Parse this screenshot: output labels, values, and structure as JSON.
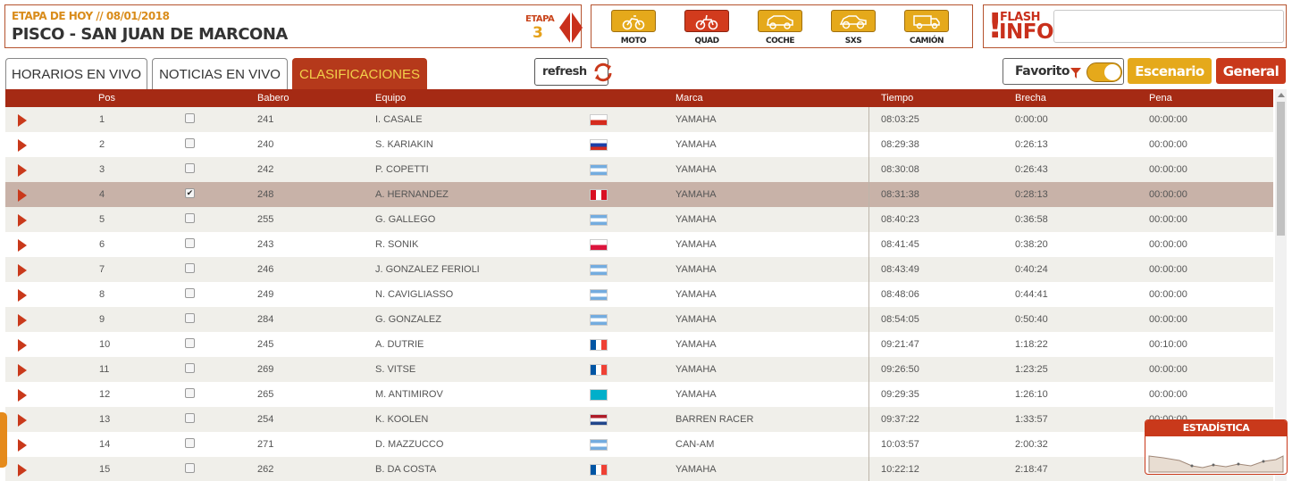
{
  "header": {
    "stage_label": "ETAPA DE HOY // 08/01/2018",
    "stage_name": "PISCO - SAN JUAN DE MARCONA",
    "etapa_label": "ETAPA",
    "etapa_number": "3"
  },
  "categories": [
    {
      "label": "MOTO",
      "icon": "motorbike-icon",
      "active": false
    },
    {
      "label": "QUAD",
      "icon": "quad-icon",
      "active": true
    },
    {
      "label": "COCHE",
      "icon": "car-icon",
      "active": false
    },
    {
      "label": "SXS",
      "icon": "sxs-icon",
      "active": false
    },
    {
      "label": "CAMIÓN",
      "icon": "truck-icon",
      "active": false
    }
  ],
  "flash": {
    "line1": "FLASH",
    "line2": "INFO"
  },
  "tabs": [
    {
      "label": "HORARIOS EN VIVO",
      "active": false
    },
    {
      "label": "NOTICIAS EN VIVO",
      "active": false
    },
    {
      "label": "CLASIFICACIONES",
      "active": true
    }
  ],
  "toolbar": {
    "refresh_label": "refresh",
    "favorito_label": "Favorito",
    "escenario_label": "Escenario",
    "general_label": "General"
  },
  "table": {
    "columns": {
      "pos": "Pos",
      "babero": "Babero",
      "equipo": "Equipo",
      "marca": "Marca",
      "tiempo": "Tiempo",
      "brecha": "Brecha",
      "pena": "Pena"
    },
    "rows": [
      {
        "pos": "1",
        "babero": "241",
        "equipo": "I. CASALE",
        "flag": "chile",
        "marca": "YAMAHA",
        "tiempo": "08:03:25",
        "brecha": "0:00:00",
        "pena": "00:00:00",
        "checked": false
      },
      {
        "pos": "2",
        "babero": "240",
        "equipo": "S. KARIAKIN",
        "flag": "russia",
        "marca": "YAMAHA",
        "tiempo": "08:29:38",
        "brecha": "0:26:13",
        "pena": "00:00:00",
        "checked": false
      },
      {
        "pos": "3",
        "babero": "242",
        "equipo": "P. COPETTI",
        "flag": "argentina",
        "marca": "YAMAHA",
        "tiempo": "08:30:08",
        "brecha": "0:26:43",
        "pena": "00:00:00",
        "checked": false
      },
      {
        "pos": "4",
        "babero": "248",
        "equipo": "A. HERNANDEZ",
        "flag": "peru",
        "marca": "YAMAHA",
        "tiempo": "08:31:38",
        "brecha": "0:28:13",
        "pena": "00:00:00",
        "checked": true
      },
      {
        "pos": "5",
        "babero": "255",
        "equipo": "G. GALLEGO",
        "flag": "argentina",
        "marca": "YAMAHA",
        "tiempo": "08:40:23",
        "brecha": "0:36:58",
        "pena": "00:00:00",
        "checked": false
      },
      {
        "pos": "6",
        "babero": "243",
        "equipo": "R. SONIK",
        "flag": "poland",
        "marca": "YAMAHA",
        "tiempo": "08:41:45",
        "brecha": "0:38:20",
        "pena": "00:00:00",
        "checked": false
      },
      {
        "pos": "7",
        "babero": "246",
        "equipo": "J. GONZALEZ FERIOLI",
        "flag": "argentina",
        "marca": "YAMAHA",
        "tiempo": "08:43:49",
        "brecha": "0:40:24",
        "pena": "00:00:00",
        "checked": false
      },
      {
        "pos": "8",
        "babero": "249",
        "equipo": "N. CAVIGLIASSO",
        "flag": "argentina",
        "marca": "YAMAHA",
        "tiempo": "08:48:06",
        "brecha": "0:44:41",
        "pena": "00:00:00",
        "checked": false
      },
      {
        "pos": "9",
        "babero": "284",
        "equipo": "G. GONZALEZ",
        "flag": "argentina",
        "marca": "YAMAHA",
        "tiempo": "08:54:05",
        "brecha": "0:50:40",
        "pena": "00:00:00",
        "checked": false
      },
      {
        "pos": "10",
        "babero": "245",
        "equipo": "A. DUTRIE",
        "flag": "france",
        "marca": "YAMAHA",
        "tiempo": "09:21:47",
        "brecha": "1:18:22",
        "pena": "00:10:00",
        "checked": false
      },
      {
        "pos": "11",
        "babero": "269",
        "equipo": "S. VITSE",
        "flag": "france",
        "marca": "YAMAHA",
        "tiempo": "09:26:50",
        "brecha": "1:23:25",
        "pena": "00:00:00",
        "checked": false
      },
      {
        "pos": "12",
        "babero": "265",
        "equipo": "M. ANTIMIROV",
        "flag": "kazakhstan",
        "marca": "YAMAHA",
        "tiempo": "09:29:35",
        "brecha": "1:26:10",
        "pena": "00:00:00",
        "checked": false
      },
      {
        "pos": "13",
        "babero": "254",
        "equipo": "K. KOOLEN",
        "flag": "netherlands",
        "marca": "BARREN RACER",
        "tiempo": "09:37:22",
        "brecha": "1:33:57",
        "pena": "00:00:00",
        "checked": false
      },
      {
        "pos": "14",
        "babero": "271",
        "equipo": "D. MAZZUCCO",
        "flag": "argentina",
        "marca": "CAN-AM",
        "tiempo": "10:03:57",
        "brecha": "2:00:32",
        "pena": "",
        "checked": false
      },
      {
        "pos": "15",
        "babero": "262",
        "equipo": "B. DA COSTA",
        "flag": "france",
        "marca": "YAMAHA",
        "tiempo": "10:22:12",
        "brecha": "2:18:47",
        "pena": "",
        "checked": false
      }
    ]
  },
  "stats": {
    "title": "ESTADÍSTICA"
  },
  "colors": {
    "accent_red": "#c9391b",
    "accent_yellow": "#e5a91b",
    "header_dark_red": "#a52a14"
  }
}
